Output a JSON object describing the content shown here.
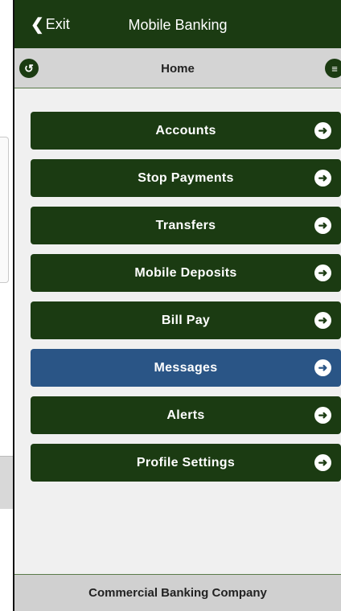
{
  "header": {
    "exit_label": "Exit",
    "title": "Mobile Banking"
  },
  "subheader": {
    "title": "Home"
  },
  "menu": {
    "items": [
      {
        "label": "Accounts"
      },
      {
        "label": "Stop Payments"
      },
      {
        "label": "Transfers"
      },
      {
        "label": "Mobile Deposits"
      },
      {
        "label": "Bill Pay"
      },
      {
        "label": "Messages"
      },
      {
        "label": "Alerts"
      },
      {
        "label": "Profile Settings"
      }
    ]
  },
  "footer": {
    "text": "Commercial Banking Company"
  },
  "colors": {
    "primary_green": "#1b3b12",
    "active_blue": "#2a5586",
    "bar_gray": "#d4d4d4"
  },
  "icons": {
    "back": "back-circle-icon",
    "menu": "menu-circle-icon",
    "item_arrow": "arrow-right-circle-icon",
    "exit_chevron": "chevron-left-icon"
  }
}
